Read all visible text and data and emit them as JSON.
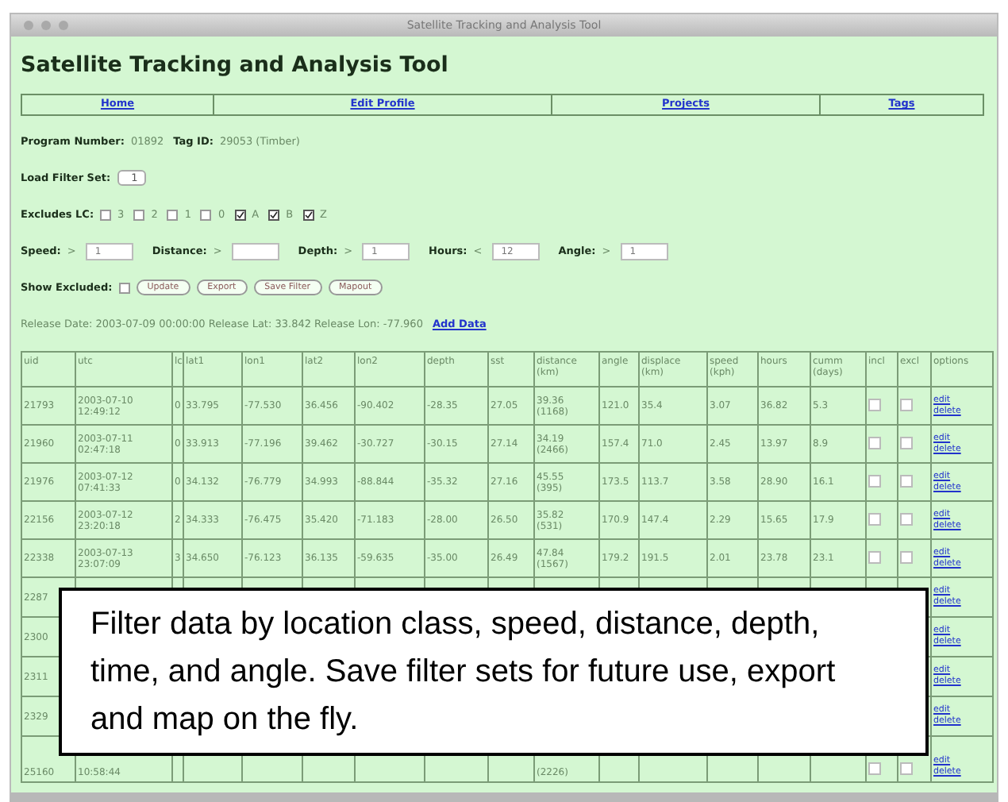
{
  "window": {
    "title": "Satellite Tracking and Analysis Tool"
  },
  "heading": "Satellite Tracking and Analysis Tool",
  "nav": [
    "Home",
    "Edit Profile",
    "Projects",
    "Tags"
  ],
  "program": [
    {
      "label": "Program Number:",
      "value": "01892"
    },
    {
      "label": "Tag ID:",
      "value": "29053 (Timber)"
    }
  ],
  "load_filter": {
    "label": "Load Filter Set:",
    "value": "1"
  },
  "excludes": {
    "label": "Excludes LC:",
    "options": [
      {
        "label": "3",
        "checked": false
      },
      {
        "label": "2",
        "checked": false
      },
      {
        "label": "1",
        "checked": false
      },
      {
        "label": "0",
        "checked": false
      },
      {
        "label": "A",
        "checked": true
      },
      {
        "label": "B",
        "checked": true
      },
      {
        "label": "Z",
        "checked": true
      }
    ]
  },
  "filters": [
    {
      "label": "Speed:",
      "op": ">",
      "value": "1"
    },
    {
      "label": "Distance:",
      "op": ">"
    },
    {
      "label": "Depth:",
      "op": ">",
      "value": "1"
    },
    {
      "label": "Hours:",
      "op": "<",
      "value": "12"
    },
    {
      "label": "Angle:",
      "op": ">",
      "value": "1"
    }
  ],
  "show_excluded": {
    "label": "Show Excluded:",
    "checked": false
  },
  "buttons": [
    "Update",
    "Export",
    "Save Filter",
    "Mapout"
  ],
  "release": {
    "text": "Release Date: 2003-07-09 00:00:00 Release Lat: 33.842 Release Lon: -77.960",
    "link": "Add Data"
  },
  "table": {
    "columns": [
      "uid",
      "utc",
      "lc",
      "lat1",
      "lon1",
      "lat2",
      "lon2",
      "depth",
      "sst",
      "distance (km)",
      "angle",
      "displace (km)",
      "speed (kph)",
      "hours",
      "cumm (days)",
      "incl",
      "excl",
      "options"
    ],
    "rows": [
      {
        "cells": [
          "21793",
          [
            "2003-07-10",
            "12:49:12"
          ],
          "0",
          "33.795",
          "-77.530",
          "36.456",
          "-90.402",
          "-28.35",
          "27.05",
          [
            "39.36",
            "(1168)"
          ],
          "121.0",
          "35.4",
          "3.07",
          "36.82",
          "5.3"
        ],
        "incl": false,
        "excl": false,
        "options": [
          "edit",
          "delete"
        ]
      },
      {
        "cells": [
          "21960",
          [
            "2003-07-11",
            "02:47:18"
          ],
          "0",
          "33.913",
          "-77.196",
          "39.462",
          "-30.727",
          "-30.15",
          "27.14",
          [
            "34.19",
            "(2466)"
          ],
          "157.4",
          "71.0",
          "2.45",
          "13.97",
          "8.9"
        ],
        "incl": false,
        "excl": false,
        "options": [
          "edit",
          "delete"
        ]
      },
      {
        "cells": [
          "21976",
          [
            "2003-07-12",
            "07:41:33"
          ],
          "0",
          "34.132",
          "-76.779",
          "34.993",
          "-88.844",
          "-35.32",
          "27.16",
          [
            "45.55",
            "(395)"
          ],
          "173.5",
          "113.7",
          "3.58",
          "28.90",
          "16.1"
        ],
        "incl": false,
        "excl": false,
        "options": [
          "edit",
          "delete"
        ]
      },
      {
        "cells": [
          "22156",
          [
            "2003-07-12",
            "23:20:18"
          ],
          "2",
          "34.333",
          "-76.475",
          "35.420",
          "-71.183",
          "-28.00",
          "26.50",
          [
            "35.82",
            "(531)"
          ],
          "170.9",
          "147.4",
          "2.29",
          "15.65",
          "17.9"
        ],
        "incl": false,
        "excl": false,
        "options": [
          "edit",
          "delete"
        ]
      },
      {
        "cells": [
          "22338",
          [
            "2003-07-13",
            "23:07:09"
          ],
          "3",
          "34.650",
          "-76.123",
          "36.135",
          "-59.635",
          "-35.00",
          "26.49",
          [
            "47.84",
            "(1567)"
          ],
          "179.2",
          "191.5",
          "2.01",
          "23.78",
          "23.1"
        ],
        "incl": false,
        "excl": false,
        "options": [
          "edit",
          "delete"
        ]
      },
      {
        "cells": [
          "2287",
          null,
          null,
          null,
          null,
          null,
          null,
          null,
          null,
          null,
          null,
          null,
          null,
          null,
          null
        ],
        "options": [
          "edit",
          "delete"
        ]
      },
      {
        "cells": [
          "2300",
          null,
          null,
          null,
          null,
          null,
          null,
          null,
          null,
          null,
          null,
          null,
          null,
          null,
          null
        ],
        "options": [
          "edit",
          "delete"
        ]
      },
      {
        "cells": [
          "2311",
          null,
          null,
          null,
          null,
          null,
          null,
          null,
          null,
          null,
          null,
          null,
          null,
          null,
          null
        ],
        "options": [
          "edit",
          "delete"
        ]
      },
      {
        "cells": [
          "2329",
          null,
          null,
          null,
          null,
          null,
          null,
          null,
          null,
          null,
          null,
          null,
          null,
          null,
          null
        ],
        "options": [
          "edit",
          "delete"
        ]
      },
      {
        "cells": [
          "25160",
          [
            "10:58:44"
          ],
          null,
          null,
          null,
          null,
          null,
          null,
          null,
          [
            "(2226)"
          ],
          null,
          null,
          null,
          null,
          null
        ],
        "incl": false,
        "excl": false,
        "options": [
          "edit",
          "delete"
        ]
      }
    ]
  },
  "callout": "Filter data by location class, speed, distance, depth, time, and angle. Save filter sets for future use, export and map on the fly."
}
